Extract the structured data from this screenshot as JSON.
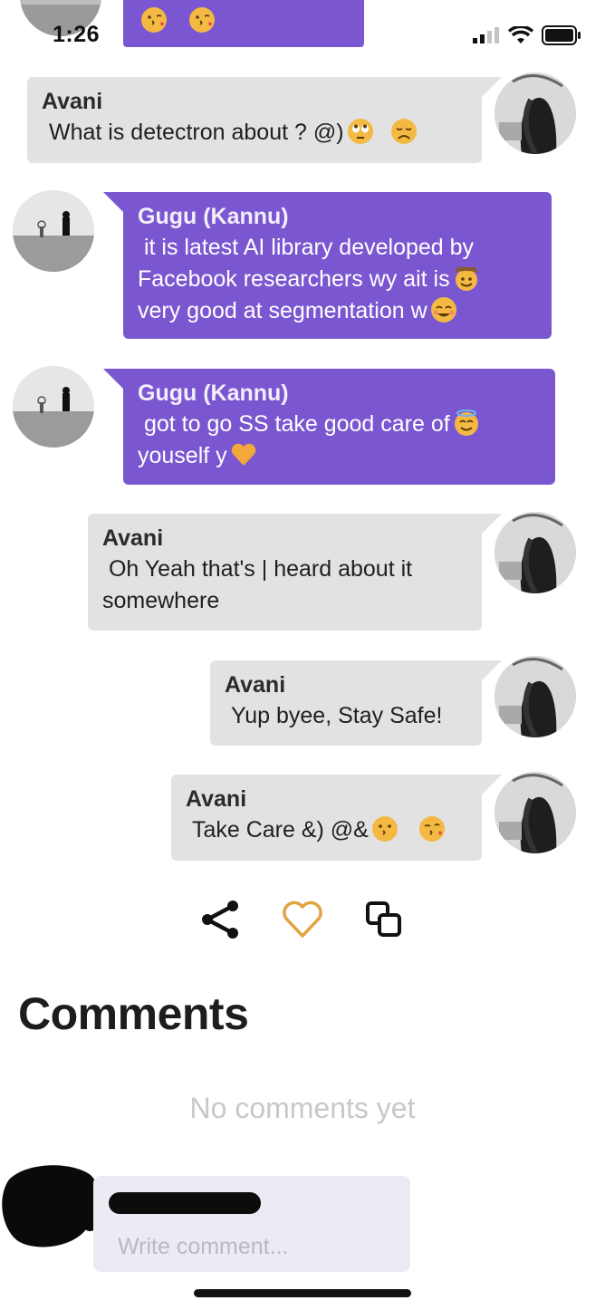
{
  "status_bar": {
    "time": "1:26"
  },
  "messages": [
    {
      "sender": "",
      "text": "",
      "emojis": [
        "kiss",
        "kiss"
      ]
    },
    {
      "sender": "Avani",
      "text": "What is detectron about ? @)",
      "emojis": [
        "eyeroll",
        "frown"
      ]
    },
    {
      "sender": "Gugu (Kannu)",
      "lines": [
        " it is latest AI library developed by",
        "Facebook researchers wy ait is",
        "very good at segmentation w"
      ],
      "emojis": [
        "cowboy",
        "smile-closed"
      ]
    },
    {
      "sender": "Gugu (Kannu)",
      "lines": [
        " got to go SS take good care of",
        "youself y"
      ],
      "emojis": [
        "halo",
        "heart"
      ]
    },
    {
      "sender": "Avani",
      "lines": [
        " Oh Yeah that's | heard about it",
        "somewhere"
      ]
    },
    {
      "sender": "Avani",
      "text": " Yup byee, Stay Safe!"
    },
    {
      "sender": "Avani",
      "text": " Take Care &) @&",
      "emojis": [
        "kiss",
        "kiss"
      ]
    }
  ],
  "comments": {
    "title": "Comments",
    "empty_text": "No comments yet",
    "input_placeholder": "Write comment..."
  },
  "colors": {
    "purple_bubble": "#7a57d1",
    "gray_bubble": "#e2e2e2",
    "heart": "#e0a441",
    "emoji": "#f4b942"
  }
}
